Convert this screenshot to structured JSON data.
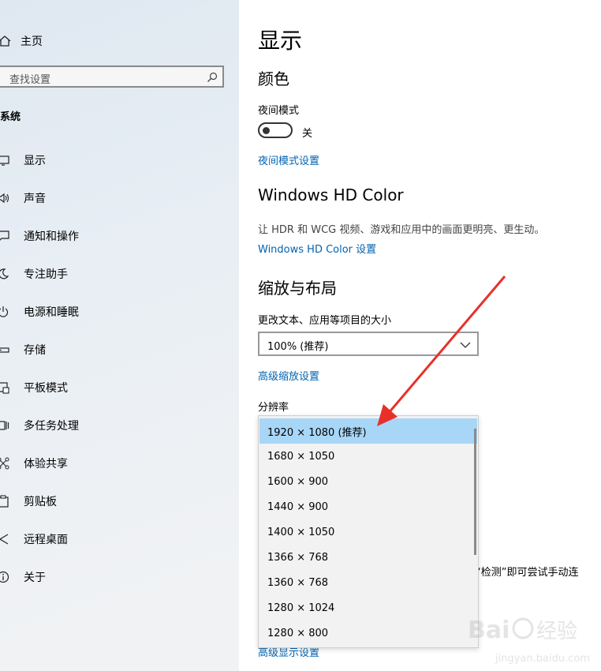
{
  "sidebar": {
    "home_label": "主页",
    "search_placeholder": "查找设置",
    "section_title": "系统",
    "items": [
      {
        "label": "显示",
        "icon": "monitor-icon"
      },
      {
        "label": "声音",
        "icon": "speaker-icon"
      },
      {
        "label": "通知和操作",
        "icon": "notification-icon"
      },
      {
        "label": "专注助手",
        "icon": "moon-icon"
      },
      {
        "label": "电源和睡眠",
        "icon": "power-icon"
      },
      {
        "label": "存储",
        "icon": "storage-icon"
      },
      {
        "label": "平板模式",
        "icon": "tablet-icon"
      },
      {
        "label": "多任务处理",
        "icon": "multitask-icon"
      },
      {
        "label": "体验共享",
        "icon": "share-icon"
      },
      {
        "label": "剪贴板",
        "icon": "clipboard-icon"
      },
      {
        "label": "远程桌面",
        "icon": "remote-icon"
      },
      {
        "label": "关于",
        "icon": "info-icon"
      }
    ]
  },
  "main": {
    "page_title": "显示",
    "color_heading": "颜色",
    "night_mode_label": "夜间模式",
    "night_mode_state": "关",
    "night_mode_on": false,
    "night_mode_link": "夜间模式设置",
    "hdr_heading": "Windows HD Color",
    "hdr_desc": "让 HDR 和 WCG 视频、游戏和应用中的画面更明亮、更生动。",
    "hdr_link": "Windows HD Color 设置",
    "scale_heading": "缩放与布局",
    "scale_label": "更改文本、应用等项目的大小",
    "scale_value": "100% (推荐)",
    "scale_link": "高级缩放设置",
    "resolution_label": "分辨率",
    "resolution_options": [
      "1920 × 1080 (推荐)",
      "1680 × 1050",
      "1600 × 900",
      "1440 × 900",
      "1400 × 1050",
      "1366 × 768",
      "1360 × 768",
      "1280 × 1024",
      "1280 × 800"
    ],
    "resolution_selected": "1920 × 1080 (推荐)",
    "detect_text_partial": "“检测”即可尝试手动连",
    "advanced_display_link_partial": "高级显示设置"
  },
  "colors": {
    "link": "#0063b1",
    "selected_option": "#a8d6f7",
    "arrow": "#e8302a"
  }
}
